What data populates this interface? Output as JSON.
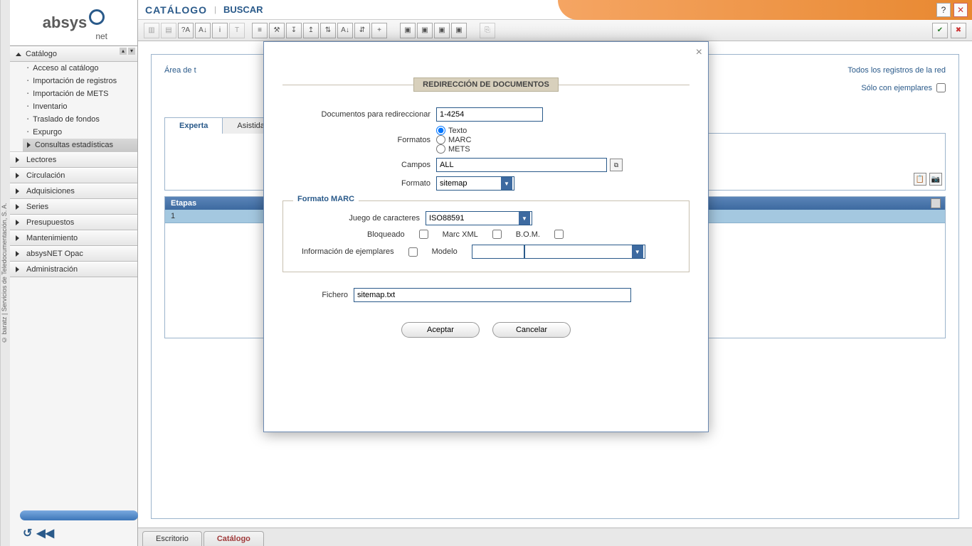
{
  "brand": {
    "name": "absys",
    "sub": "net",
    "copyright": "© baratz | Servicios de Teledocumentación, S. A."
  },
  "header": {
    "title": "CATÁLOGO",
    "action": "BUSCAR"
  },
  "header_icons": {
    "help": "?",
    "close": "✕"
  },
  "sidebar": {
    "catalogo": {
      "label": "Catálogo",
      "items": {
        "acceso": "Acceso al catálogo",
        "imp_reg": "Importación de registros",
        "imp_mets": "Importación de METS",
        "inventario": "Inventario",
        "traslado": "Traslado de fondos",
        "expurgo": "Expurgo",
        "consultas": "Consultas estadísticas"
      }
    },
    "sections": {
      "lectores": "Lectores",
      "circulacion": "Circulación",
      "adquisiciones": "Adquisiciones",
      "series": "Series",
      "presupuestos": "Presupuestos",
      "mantenimiento": "Mantenimiento",
      "opac": "absysNET Opac",
      "admin": "Administración"
    }
  },
  "main": {
    "area_label": "Área de t",
    "todos_red": "Todos los registros de la red",
    "solo_ejemplares": "Sólo con ejemplares",
    "tabs": {
      "experta": "Experta",
      "asistida": "Asistida"
    },
    "table": {
      "header": "Etapas",
      "row1": "1"
    }
  },
  "bottom_tabs": {
    "escritorio": "Escritorio",
    "catalogo": "Catálogo"
  },
  "modal": {
    "title": "REDIRECCIÓN DE DOCUMENTOS",
    "docs_label": "Documentos para redireccionar",
    "docs_value": "1-4254",
    "formatos_label": "Formatos",
    "radio": {
      "texto": "Texto",
      "marc": "MARC",
      "mets": "METS"
    },
    "campos_label": "Campos",
    "campos_value": "ALL",
    "formato_label": "Formato",
    "formato_value": "sitemap",
    "fieldset": {
      "legend": "Formato MARC",
      "juego_label": "Juego de caracteres",
      "juego_value": "ISO88591",
      "bloqueado": "Bloqueado",
      "marcxml": "Marc XML",
      "bom": "B.O.M.",
      "info_ej": "Información de ejemplares",
      "modelo": "Modelo"
    },
    "fichero_label": "Fichero",
    "fichero_value": "sitemap.txt",
    "aceptar": "Aceptar",
    "cancelar": "Cancelar"
  }
}
